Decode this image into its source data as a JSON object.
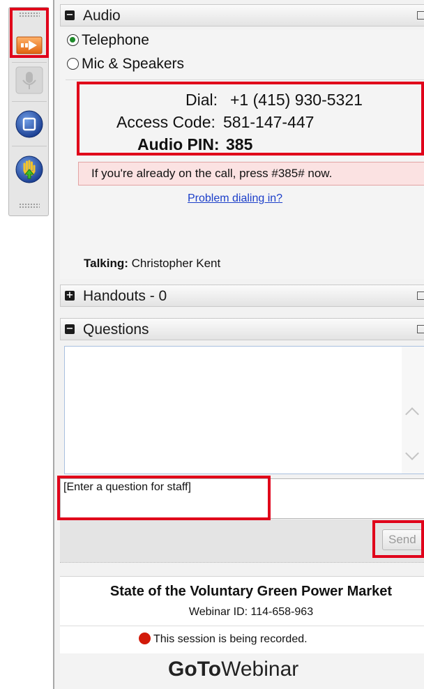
{
  "audio": {
    "title": "Audio",
    "toggle": "−",
    "options": [
      "Telephone",
      "Mic & Speakers"
    ],
    "selected": "Telephone",
    "dial_label": "Dial:",
    "dial_value": "+1 (415) 930-5321",
    "access_label": "Access Code:",
    "access_value": "581-147-447",
    "pin_label": "Audio PIN:",
    "pin_value": "385",
    "notice": "If you're already on the call, press #385# now.",
    "problem_link": "Problem dialing in?",
    "talking_label": "Talking:",
    "talking_name": "Christopher Kent"
  },
  "handouts": {
    "title": "Handouts - 0",
    "toggle": "+"
  },
  "questions": {
    "title": "Questions",
    "toggle": "−",
    "input_placeholder": "[Enter a question for staff]",
    "send_label": "Send"
  },
  "footer": {
    "webinar_title": "State of the Voluntary Green Power Market",
    "webinar_id": "Webinar ID: 114-658-963",
    "recording_notice": "This session is being recorded.",
    "brand_goto": "GoTo",
    "brand_webinar": "Webinar"
  },
  "icons": {
    "grabtab": [
      "arrow-right-icon",
      "microphone-icon",
      "screen-icon",
      "raise-hand-icon"
    ]
  },
  "colors": {
    "highlight": "#e0001a",
    "recording": "#d21a0a",
    "link": "#1b3ec9",
    "tab_orange": "#e8711c"
  }
}
